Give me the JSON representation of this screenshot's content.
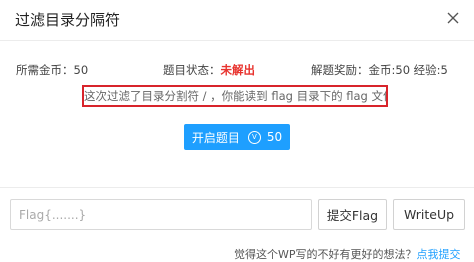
{
  "dialog": {
    "title": "过滤目录分隔符"
  },
  "info": {
    "cost_label": "所需金币：",
    "cost_value": "50",
    "status_label": "题目状态：",
    "status_value": "未解出",
    "reward_text": "解题奖励：金币:50 经验:5"
  },
  "description": "这次过滤了目录分割符 / ，你能读到 flag 目录下的 flag 文件吗",
  "start_button": {
    "label": "开启题目",
    "coin_symbol": "V",
    "cost": "50"
  },
  "flag_input": {
    "placeholder": "Flag{.......}",
    "value": ""
  },
  "submit_button": {
    "label": "提交Flag"
  },
  "writeup_button": {
    "label": "WriteUp"
  },
  "footer": {
    "text": "觉得这个WP写的不好有更好的想法？",
    "link_label": "点我提交"
  },
  "colors": {
    "primary": "#1e9fff",
    "unsolved": "#e8332e",
    "highlight_border": "#d8242b"
  }
}
